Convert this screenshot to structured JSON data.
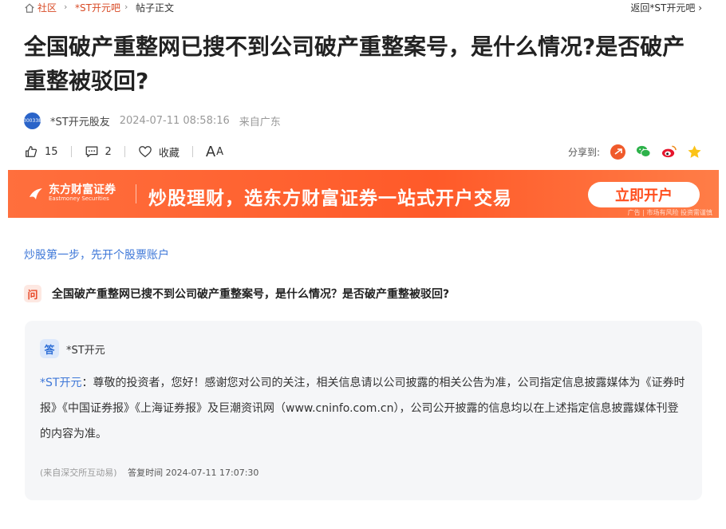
{
  "breadcrumb": {
    "items": [
      "社区",
      "*ST开元吧",
      "帖子正文"
    ],
    "back_label": "返回*ST开元吧"
  },
  "post": {
    "title": "全国破产重整网已搜不到公司破产重整案号，是什么情况?是否破产重整被驳回?",
    "author": "*ST开元股友",
    "avatar_text": "300338",
    "time": "2024-07-11 08:58:16",
    "location": "来自广东"
  },
  "actions": {
    "likes": "15",
    "comments": "2",
    "favorite_label": "收藏",
    "font_label_big": "A",
    "font_label_small": "A"
  },
  "share": {
    "label": "分享到:",
    "icons": [
      "yidong-icon",
      "wechat-icon",
      "weibo-icon",
      "qzone-icon"
    ]
  },
  "banner": {
    "brand_cn": "东方财富证券",
    "brand_en": "Eastmoney Securities",
    "slogan": "炒股理财，选东方财富证券一站式开户交易",
    "cta": "立即开户",
    "disclaimer": "广告 | 市场有风险 投资需谨慎"
  },
  "promo_link": "炒股第一步，先开个股票账户",
  "qa": {
    "q_badge": "问",
    "question": "全国破产重整网已搜不到公司破产重整案号，是什么情况？是否破产重整被驳回?",
    "a_badge": "答",
    "company": "*ST开元",
    "answer_who": "*ST开元",
    "answer_text": "：尊敬的投资者，您好！感谢您对公司的关注，相关信息请以公司披露的相关公告为准，公司指定信息披露媒体为《证券时报》《中国证券报》《上海证券报》及巨潮资讯网（www.cninfo.com.cn），公司公开披露的信息均以在上述指定信息披露媒体刊登的内容为准。",
    "source": "(来自深交所互动易)",
    "reply_time": "答复时间 2024-07-11 17:07:30"
  },
  "colors": {
    "accent_red": "#d84a25",
    "link_blue": "#3f78d8",
    "banner_orange": "#ff5a29"
  }
}
